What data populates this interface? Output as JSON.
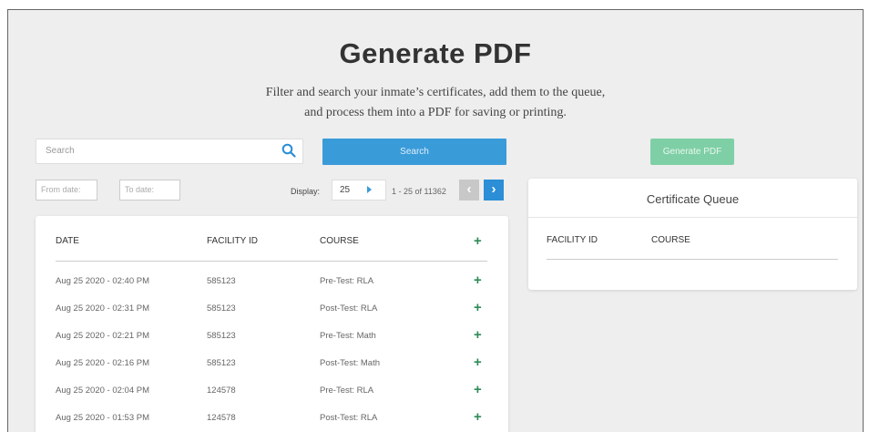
{
  "page": {
    "title": "Generate PDF",
    "subtitle_line1": "Filter and search your inmate’s certificates, add them to the queue,",
    "subtitle_line2": "and process them into a PDF for saving or printing."
  },
  "search": {
    "placeholder": "Search",
    "button_label": "Search"
  },
  "generate_button_label": "Generate PDF",
  "filters": {
    "from_date_placeholder": "From date:",
    "to_date_placeholder": "To date:"
  },
  "pagination": {
    "display_label": "Display:",
    "page_size": "25",
    "range_text": "1 - 25 of 11362",
    "prev_icon": "chevron-left-icon",
    "next_icon": "chevron-right-icon"
  },
  "results_table": {
    "columns": [
      "DATE",
      "FACILITY ID",
      "COURSE"
    ],
    "add_icon": "plus-icon",
    "rows": [
      {
        "date": "Aug 25 2020 - 02:40 PM",
        "facility_id": "585123",
        "course": "Pre-Test: RLA"
      },
      {
        "date": "Aug 25 2020 - 02:31 PM",
        "facility_id": "585123",
        "course": "Post-Test: RLA"
      },
      {
        "date": "Aug 25 2020 - 02:21 PM",
        "facility_id": "585123",
        "course": "Pre-Test: Math"
      },
      {
        "date": "Aug 25 2020 - 02:16 PM",
        "facility_id": "585123",
        "course": "Post-Test: Math"
      },
      {
        "date": "Aug 25 2020 - 02:04 PM",
        "facility_id": "124578",
        "course": "Pre-Test: RLA"
      },
      {
        "date": "Aug 25 2020 - 01:53 PM",
        "facility_id": "124578",
        "course": "Post-Test: RLA"
      }
    ]
  },
  "queue": {
    "title": "Certificate Queue",
    "columns": [
      "FACILITY ID",
      "COURSE"
    ]
  },
  "colors": {
    "accent_blue": "#3a9bd9",
    "generate_green": "#7fcfa6",
    "plus_green": "#2e8b57",
    "background": "#eeeeee"
  }
}
